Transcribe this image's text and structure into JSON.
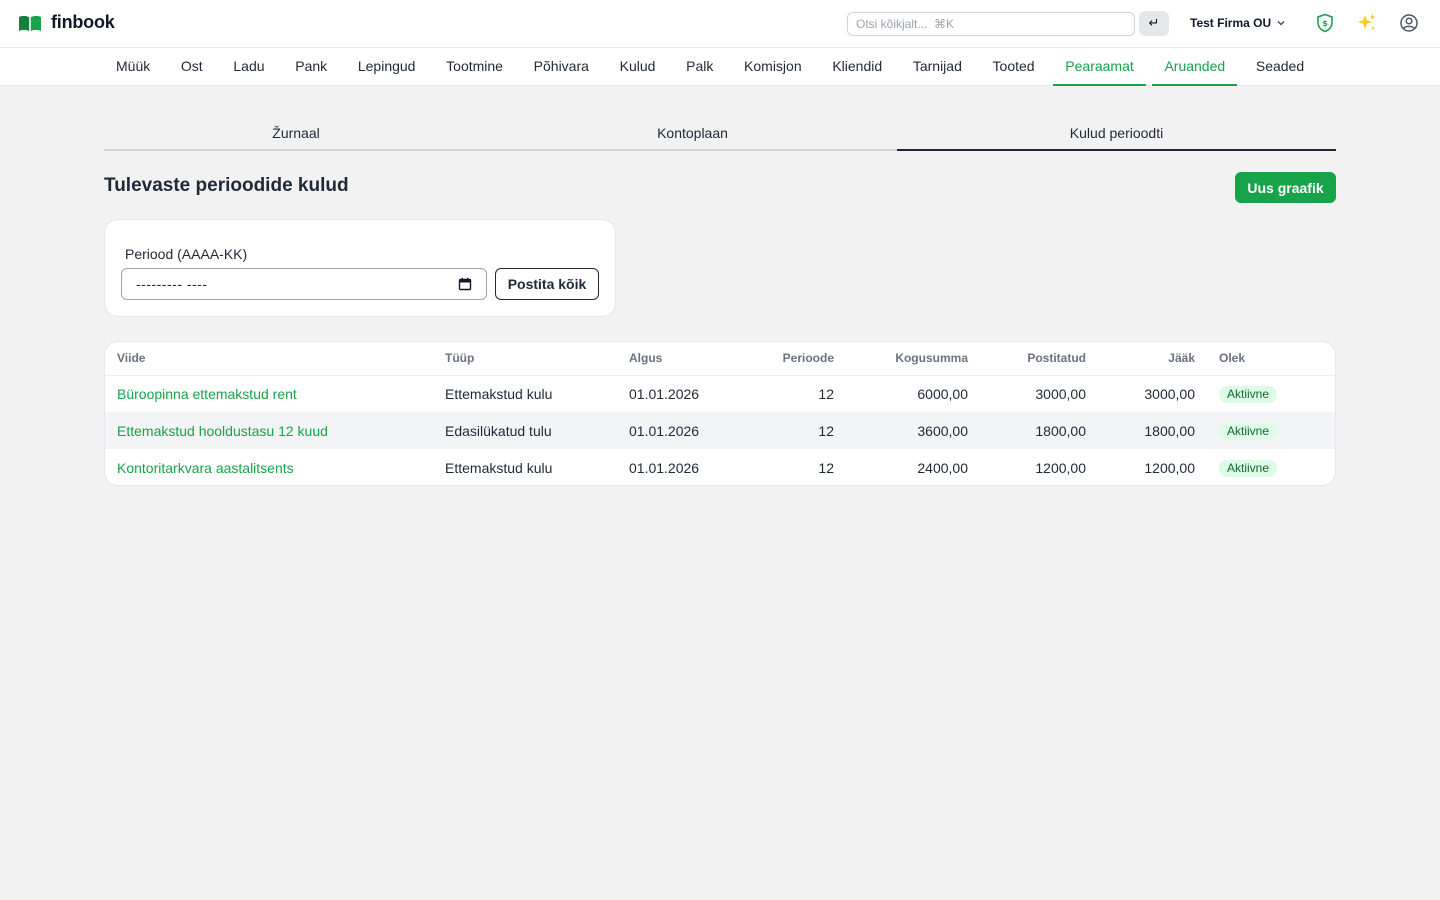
{
  "app": {
    "name": "finbook",
    "search_placeholder": "Otsi kõikjalt...  ⌘K",
    "enter_label": "↵",
    "company": "Test Firma OU"
  },
  "nav": {
    "items": [
      {
        "label": "Müük"
      },
      {
        "label": "Ost"
      },
      {
        "label": "Ladu"
      },
      {
        "label": "Pank"
      },
      {
        "label": "Lepingud"
      },
      {
        "label": "Tootmine"
      },
      {
        "label": "Põhivara"
      },
      {
        "label": "Kulud"
      },
      {
        "label": "Palk"
      },
      {
        "label": "Komisjon"
      },
      {
        "label": "Kliendid"
      },
      {
        "label": "Tarnijad"
      },
      {
        "label": "Tooted"
      },
      {
        "label": "Pearaamat"
      },
      {
        "label": "Aruanded"
      },
      {
        "label": "Seaded"
      }
    ],
    "active": [
      "Pearaamat",
      "Aruanded"
    ]
  },
  "tabs": [
    {
      "label": "Žurnaal"
    },
    {
      "label": "Kontoplaan"
    },
    {
      "label": "Kulud perioodti"
    }
  ],
  "page": {
    "title": "Tulevaste perioodide kulud",
    "new_button": "Uus graafik"
  },
  "filter": {
    "label": "Periood (AAAA-KK)",
    "value": "--------- ----",
    "post_all_button": "Postita kõik"
  },
  "table": {
    "headers": {
      "ref": "Viide",
      "type": "Tüüp",
      "start": "Algus",
      "periods": "Perioode",
      "total": "Kogusumma",
      "posted": "Postitatud",
      "remaining": "Jääk",
      "status": "Olek"
    },
    "rows": [
      {
        "ref": "Büroopinna ettemakstud rent",
        "type": "Ettemakstud kulu",
        "start": "01.01.2026",
        "periods": "12",
        "total": "6000,00",
        "posted": "3000,00",
        "remaining": "3000,00",
        "status": "Aktiivne"
      },
      {
        "ref": "Ettemakstud hooldustasu 12 kuud",
        "type": "Edasilükatud tulu",
        "start": "01.01.2026",
        "periods": "12",
        "total": "3600,00",
        "posted": "1800,00",
        "remaining": "1800,00",
        "status": "Aktiivne"
      },
      {
        "ref": "Kontoritarkvara aastalitsents",
        "type": "Ettemakstud kulu",
        "start": "01.01.2026",
        "periods": "12",
        "total": "2400,00",
        "posted": "1200,00",
        "remaining": "1200,00",
        "status": "Aktiivne"
      }
    ]
  },
  "icons": {
    "logo": "open-book-icon",
    "company_dropdown": "chevron-down-icon",
    "shield": "shield-dollar-icon",
    "sparkle": "sparkles-icon",
    "account": "user-circle-icon",
    "calendar": "calendar-icon"
  },
  "colors": {
    "brand": "#16a34a",
    "brand_dark": "#15803d",
    "badge_bg": "#dcfce7",
    "badge_text": "#166534",
    "sparkle": "#facc15"
  }
}
